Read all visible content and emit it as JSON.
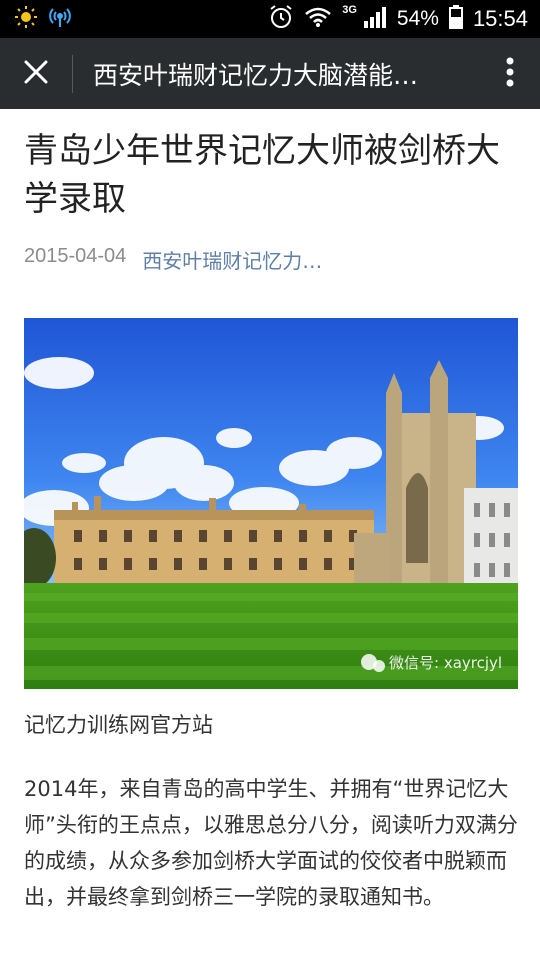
{
  "status_bar": {
    "network": "3G",
    "battery": "54%",
    "time": "15:54"
  },
  "app_bar": {
    "title": "西安叶瑞财记忆力大脑潜能…"
  },
  "article": {
    "title": "青岛少年世界记忆大师被剑桥大学录取",
    "date": "2015-04-04",
    "source": "西安叶瑞财记忆力…",
    "watermark": "微信号: xayrcjyl",
    "caption": "记忆力训练网官方站",
    "paragraph": "2014年，来自青岛的高中学生、并拥有“世界记忆大师”头衔的王点点，以雅思总分八分，阅读听力双满分的成绩，从众多参加剑桥大学面试的佼佼者中脱颖而出，并最终拿到剑桥三一学院的录取通知书。"
  },
  "colors": {
    "app_bar_bg": "#2a2d2f",
    "source_link": "#607fa6",
    "date_gray": "#8c8c8c"
  }
}
